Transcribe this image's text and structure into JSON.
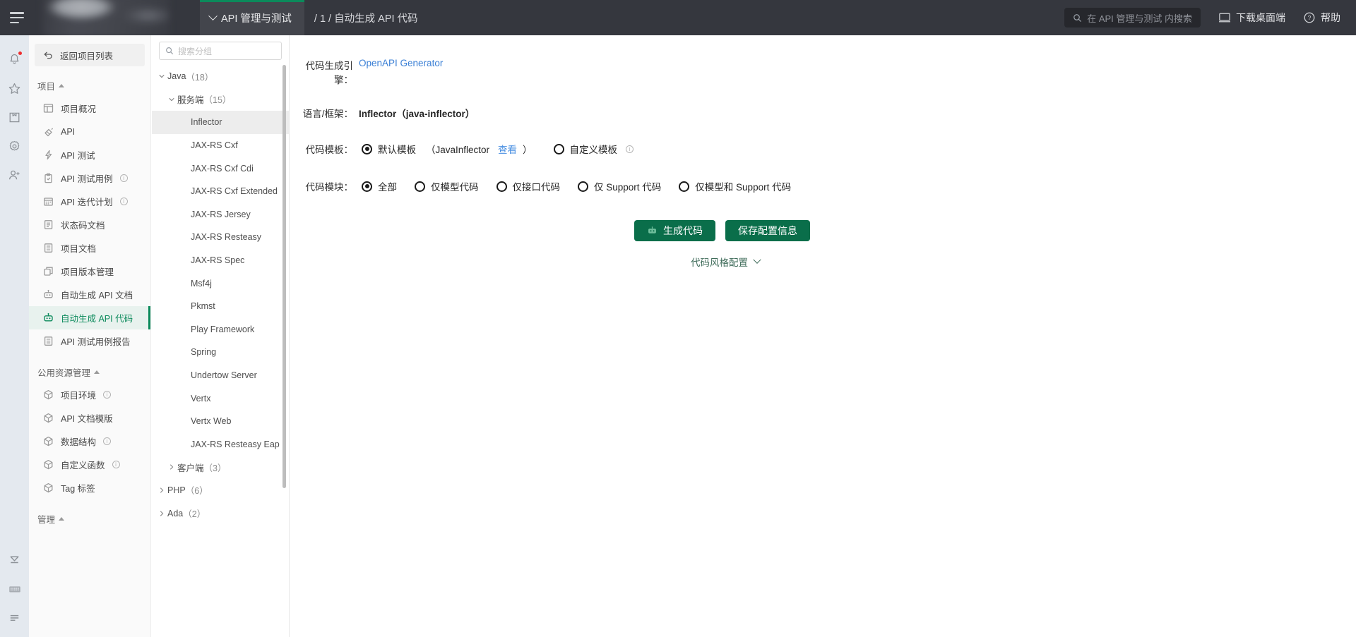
{
  "topbar": {
    "tab_label": "API 管理与测试",
    "breadcrumb": "/ 1 / 自动生成 API 代码",
    "search_placeholder": "在 API 管理与测试 内搜索",
    "desktop_label": "下载桌面端",
    "help_label": "帮助"
  },
  "rail": {
    "icons": [
      "bell-icon",
      "star-icon",
      "package-icon",
      "gear-icon",
      "add-user-icon"
    ],
    "bottom_icons": [
      "collapse-down-icon",
      "keyboard-icon",
      "list-icon"
    ]
  },
  "sidebar": {
    "back_label": "返回项目列表",
    "groups": [
      {
        "title": "项目",
        "items": [
          {
            "label": "项目概况",
            "icon": "overview-icon",
            "info": false,
            "active": false
          },
          {
            "label": "API",
            "icon": "api-icon",
            "info": false,
            "active": false
          },
          {
            "label": "API 测试",
            "icon": "lightning-icon",
            "info": false,
            "active": false
          },
          {
            "label": "API 测试用例",
            "icon": "clipboard-check-icon",
            "info": true,
            "active": false
          },
          {
            "label": "API 迭代计划",
            "icon": "calendar-icon",
            "info": true,
            "active": false
          },
          {
            "label": "状态码文档",
            "icon": "doc-code-icon",
            "info": false,
            "active": false
          },
          {
            "label": "项目文档",
            "icon": "doc-icon",
            "info": false,
            "active": false
          },
          {
            "label": "项目版本管理",
            "icon": "layers-icon",
            "info": false,
            "active": false
          },
          {
            "label": "自动生成 API 文档",
            "icon": "robot-icon",
            "info": false,
            "active": false
          },
          {
            "label": "自动生成 API 代码",
            "icon": "robot-icon",
            "info": false,
            "active": true
          },
          {
            "label": "API 测试用例报告",
            "icon": "report-icon",
            "info": false,
            "active": false
          }
        ]
      },
      {
        "title": "公用资源管理",
        "items": [
          {
            "label": "项目环境",
            "icon": "cube-icon",
            "info": true,
            "active": false
          },
          {
            "label": "API 文档模版",
            "icon": "cube-icon",
            "info": false,
            "active": false
          },
          {
            "label": "数据结构",
            "icon": "cube-icon",
            "info": true,
            "active": false
          },
          {
            "label": "自定义函数",
            "icon": "cube-icon",
            "info": true,
            "active": false
          },
          {
            "label": "Tag 标签",
            "icon": "cube-icon",
            "info": false,
            "active": false
          }
        ]
      },
      {
        "title": "管理",
        "items": []
      }
    ]
  },
  "tree": {
    "search_placeholder": "搜索分组",
    "nodes": [
      {
        "label": "Java",
        "count": "（18）",
        "level": 0,
        "expandable": true,
        "expanded": true,
        "selected": false
      },
      {
        "label": "服务端",
        "count": "（15）",
        "level": 1,
        "expandable": true,
        "expanded": true,
        "selected": false
      },
      {
        "label": "Inflector",
        "count": "",
        "level": 2,
        "expandable": false,
        "expanded": false,
        "selected": true
      },
      {
        "label": "JAX-RS Cxf",
        "count": "",
        "level": 2,
        "expandable": false,
        "expanded": false,
        "selected": false
      },
      {
        "label": "JAX-RS Cxf Cdi",
        "count": "",
        "level": 2,
        "expandable": false,
        "expanded": false,
        "selected": false
      },
      {
        "label": "JAX-RS Cxf Extended",
        "count": "",
        "level": 2,
        "expandable": false,
        "expanded": false,
        "selected": false
      },
      {
        "label": "JAX-RS Jersey",
        "count": "",
        "level": 2,
        "expandable": false,
        "expanded": false,
        "selected": false
      },
      {
        "label": "JAX-RS Resteasy",
        "count": "",
        "level": 2,
        "expandable": false,
        "expanded": false,
        "selected": false
      },
      {
        "label": "JAX-RS Spec",
        "count": "",
        "level": 2,
        "expandable": false,
        "expanded": false,
        "selected": false
      },
      {
        "label": "Msf4j",
        "count": "",
        "level": 2,
        "expandable": false,
        "expanded": false,
        "selected": false
      },
      {
        "label": "Pkmst",
        "count": "",
        "level": 2,
        "expandable": false,
        "expanded": false,
        "selected": false
      },
      {
        "label": "Play Framework",
        "count": "",
        "level": 2,
        "expandable": false,
        "expanded": false,
        "selected": false
      },
      {
        "label": "Spring",
        "count": "",
        "level": 2,
        "expandable": false,
        "expanded": false,
        "selected": false
      },
      {
        "label": "Undertow Server",
        "count": "",
        "level": 2,
        "expandable": false,
        "expanded": false,
        "selected": false
      },
      {
        "label": "Vertx",
        "count": "",
        "level": 2,
        "expandable": false,
        "expanded": false,
        "selected": false
      },
      {
        "label": "Vertx Web",
        "count": "",
        "level": 2,
        "expandable": false,
        "expanded": false,
        "selected": false
      },
      {
        "label": "JAX-RS Resteasy Eap",
        "count": "",
        "level": 2,
        "expandable": false,
        "expanded": false,
        "selected": false
      },
      {
        "label": "客户端",
        "count": "（3）",
        "level": 1,
        "expandable": true,
        "expanded": false,
        "selected": false
      },
      {
        "label": "PHP",
        "count": "（6）",
        "level": 0,
        "expandable": true,
        "expanded": false,
        "selected": false
      },
      {
        "label": "Ada",
        "count": "（2）",
        "level": 0,
        "expandable": true,
        "expanded": false,
        "selected": false
      }
    ]
  },
  "main": {
    "engine_label": "代码生成引擎：",
    "engine_value": "OpenAPI Generator",
    "lang_label": "语言/框架：",
    "lang_value": "Inflector（java-inflector）",
    "template_label": "代码模板：",
    "template_options": [
      {
        "label": "默认模板",
        "suffix": "（JavaInflector",
        "link": "查看",
        "suffix2": "）",
        "selected": true,
        "info": false
      },
      {
        "label": "自定义模板",
        "suffix": "",
        "link": "",
        "suffix2": "",
        "selected": false,
        "info": true
      }
    ],
    "module_label": "代码模块：",
    "module_options": [
      {
        "label": "全部",
        "selected": true
      },
      {
        "label": "仅模型代码",
        "selected": false
      },
      {
        "label": "仅接口代码",
        "selected": false
      },
      {
        "label": "仅 Support 代码",
        "selected": false
      },
      {
        "label": "仅模型和 Support 代码",
        "selected": false
      }
    ],
    "generate_button": "生成代码",
    "save_button": "保存配置信息",
    "style_config": "代码风格配置"
  },
  "colors": {
    "accent_green": "#0a6e4a",
    "link_blue": "#3a7fd5",
    "topbar_bg": "#35373e"
  }
}
